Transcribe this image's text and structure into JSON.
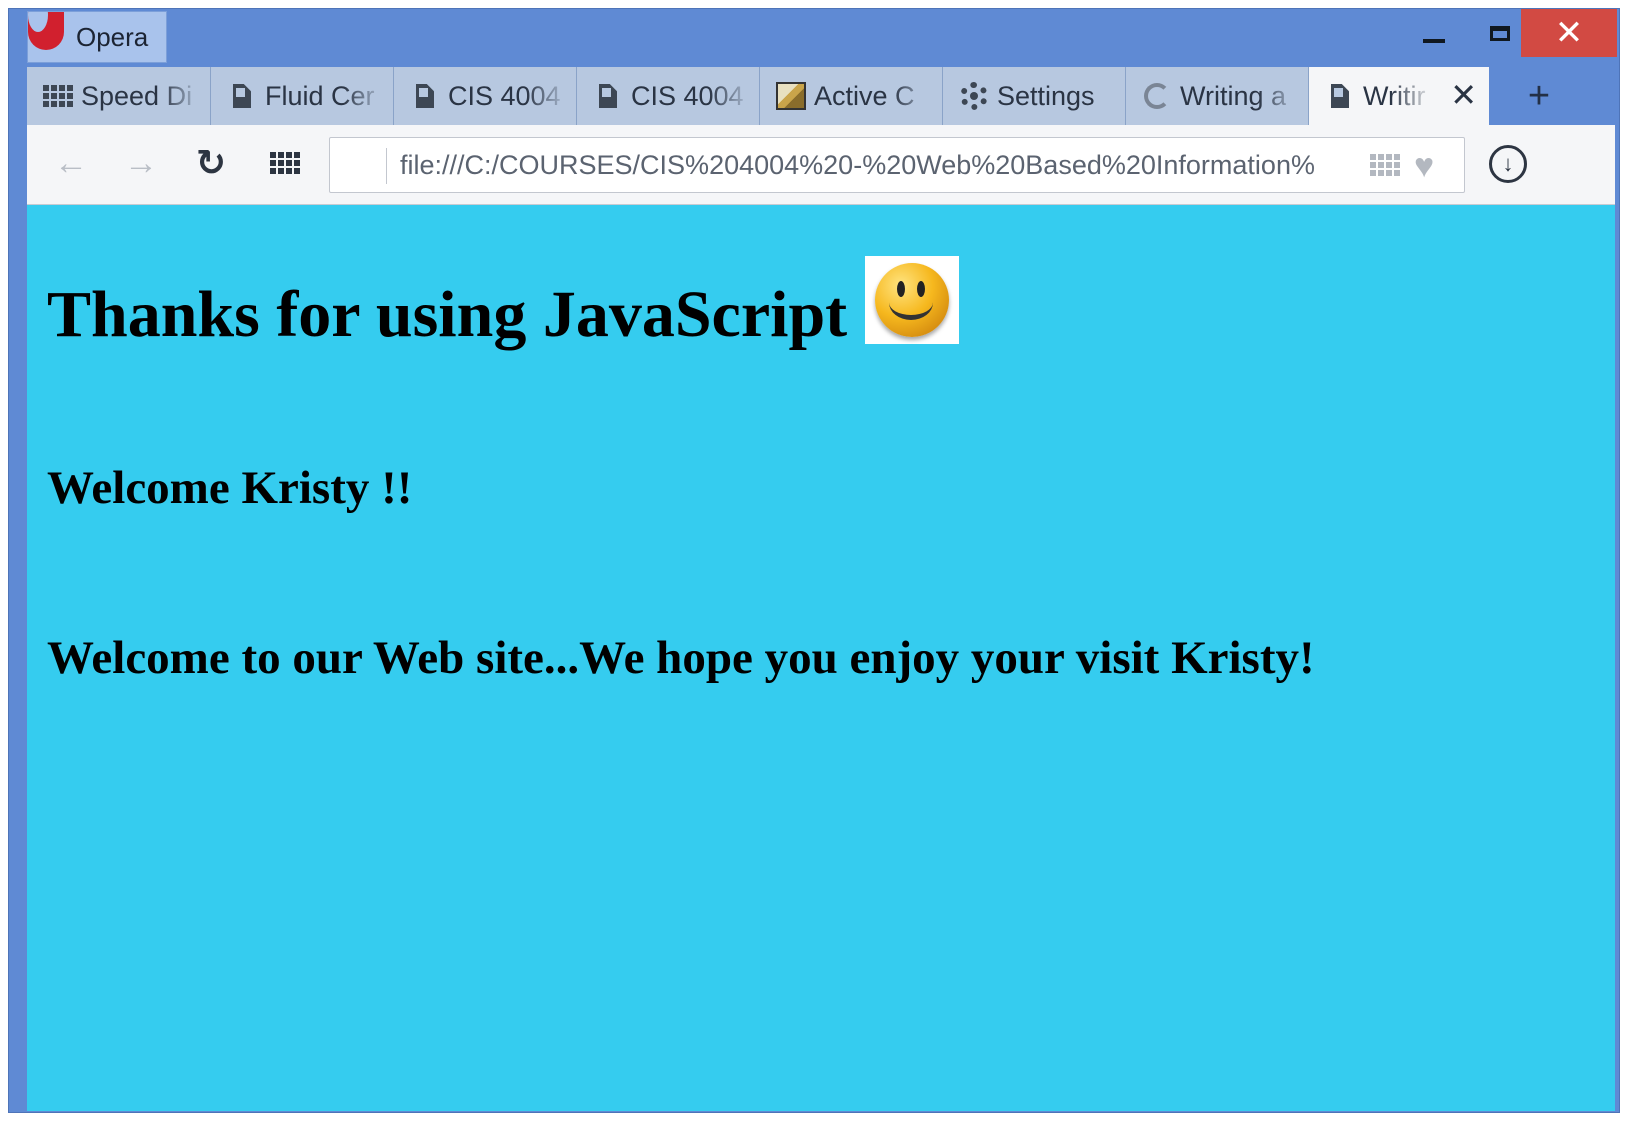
{
  "window": {
    "app_name": "Opera",
    "controls": {
      "minimize": "",
      "maximize": "",
      "close": "✕"
    },
    "colors": {
      "frame": "#5f8ad4",
      "close_button": "#d24a43",
      "page_background": "#35ccef"
    }
  },
  "tabs": [
    {
      "label": "Speed Di",
      "icon": "speed-dial-icon"
    },
    {
      "label": "Fluid Cer",
      "icon": "document-icon"
    },
    {
      "label": "CIS 4004",
      "icon": "document-icon"
    },
    {
      "label": "CIS 4004",
      "icon": "document-icon"
    },
    {
      "label": "Active C",
      "icon": "image-icon"
    },
    {
      "label": "Settings",
      "icon": "gear-icon"
    },
    {
      "label": "Writing a",
      "icon": "loading-spinner-icon"
    },
    {
      "label": "Writir",
      "icon": "document-icon",
      "active": true,
      "close": "✕"
    }
  ],
  "new_tab": "+",
  "toolbar": {
    "back": "←",
    "forward": "→",
    "reload": "↻",
    "address": "file:///C:/COURSES/CIS%204004%20-%20Web%20Based%20Information%",
    "heart": "♥",
    "download": "↓"
  },
  "page": {
    "heading": "Thanks for using JavaScript",
    "welcome_name": "Welcome Kristy !!",
    "welcome_message": "Welcome to our Web site...We hope you enjoy your visit Kristy!"
  }
}
